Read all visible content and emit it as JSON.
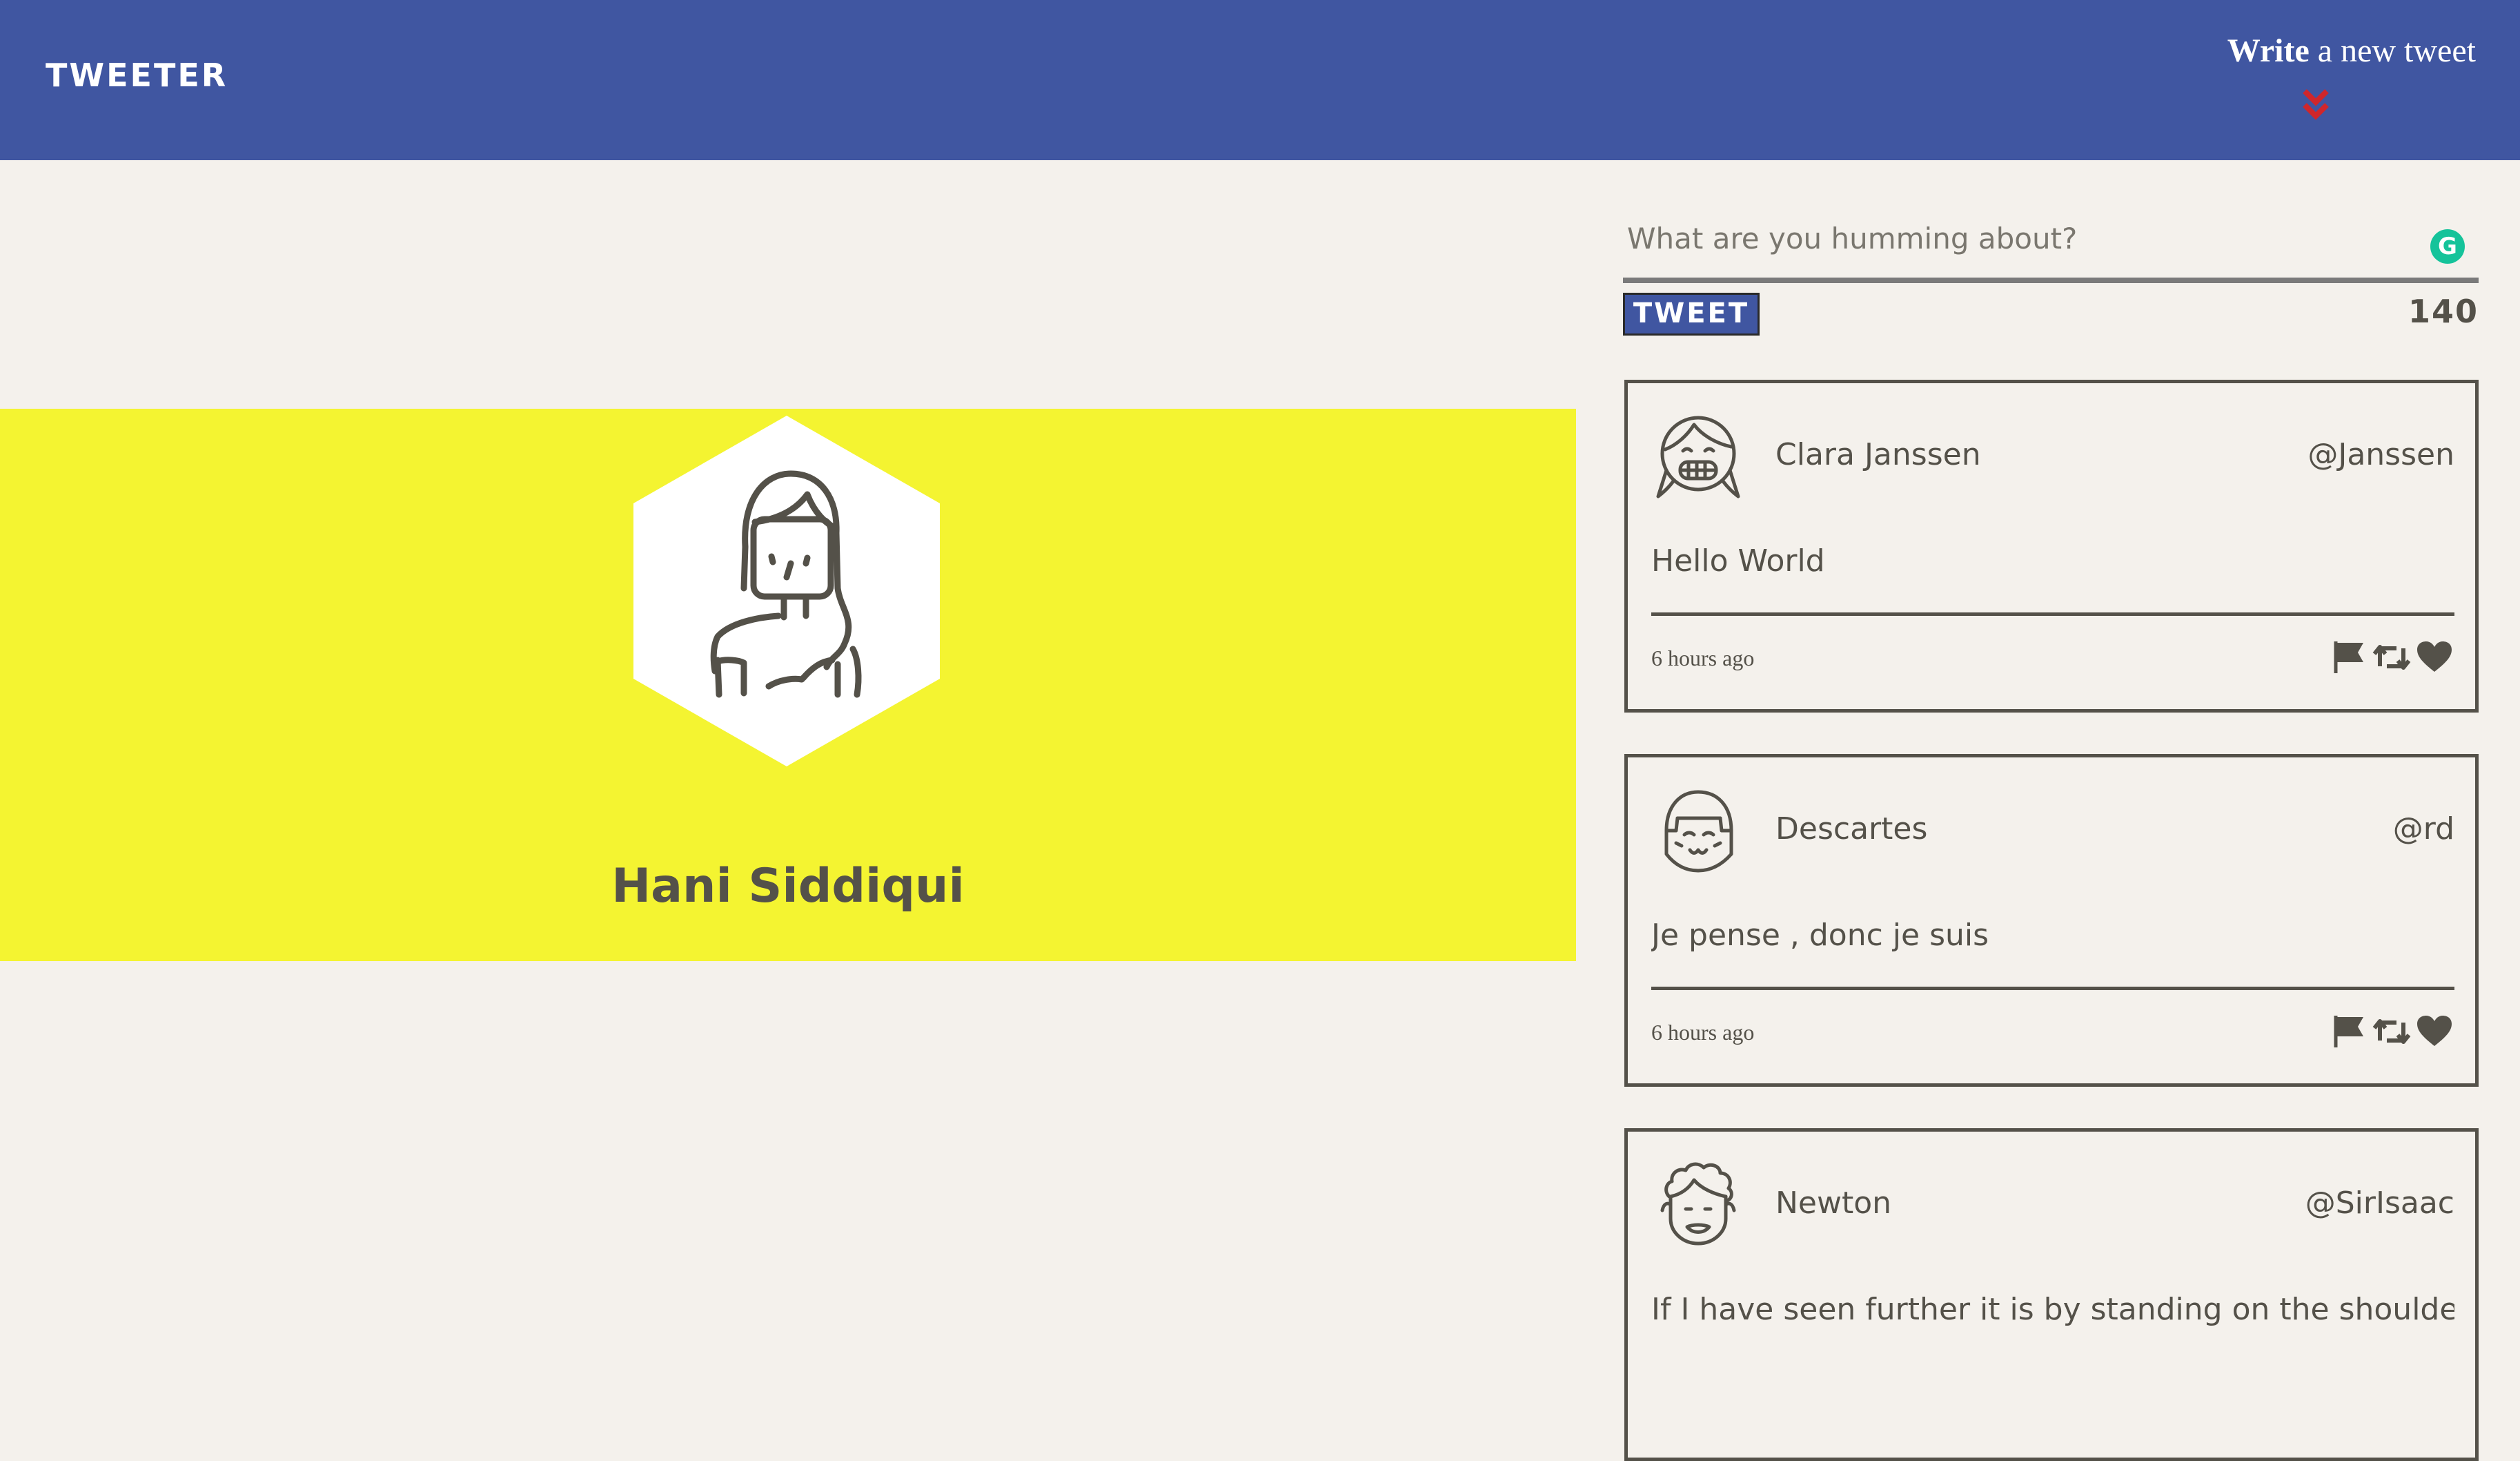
{
  "header": {
    "brand": "TWEETER",
    "write_bold": "Write",
    "write_rest": " a new tweet",
    "chevron_icon": "double-chevron-down-icon",
    "chevron_color": "#d0262b",
    "background": "#4056a1"
  },
  "profile": {
    "name": "Hani Siddiqui",
    "banner_color": "#f4f431",
    "avatar_icon": "woman-avatar-icon"
  },
  "composer": {
    "placeholder": "What are you humming about?",
    "grammarly_icon": "grammarly-icon",
    "grammarly_letter": "G",
    "button_label": "TWEET",
    "char_count": "140"
  },
  "tweets": [
    {
      "name": "Clara Janssen",
      "handle": "@Janssen",
      "text": "Hello World",
      "time": "6 hours ago",
      "avatar_icon": "girl-avatar-icon"
    },
    {
      "name": "Descartes",
      "handle": "@rd",
      "text": "Je pense , donc je suis",
      "time": "6 hours ago",
      "avatar_icon": "bob-hair-avatar-icon"
    },
    {
      "name": "Newton",
      "handle": "@SirIsaac",
      "text": "If I have seen further it is by standing on the shoulders of giants",
      "time": "",
      "avatar_icon": "curly-hair-avatar-icon"
    }
  ],
  "action_icons": [
    "flag-icon",
    "retweet-icon",
    "heart-icon"
  ]
}
